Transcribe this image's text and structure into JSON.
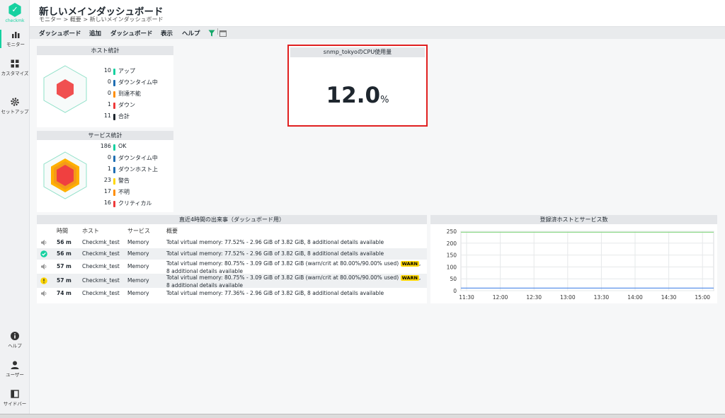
{
  "nav": {
    "logo_text": "checkmk",
    "items": [
      {
        "label": "モニター"
      },
      {
        "label": "カスタマイズ"
      },
      {
        "label": "セットアップ"
      },
      {
        "label": "ヘルプ"
      },
      {
        "label": "ユーザー"
      },
      {
        "label": "サイドバー"
      }
    ]
  },
  "header": {
    "title": "新しいメインダッシュボード",
    "breadcrumb": "モニター > 概要 > 新しいメインダッシュボード"
  },
  "menu": [
    "ダッシュボード",
    "追加",
    "ダッシュボード",
    "表示",
    "ヘルプ"
  ],
  "host_stats": {
    "title": "ホスト統計",
    "rows": [
      {
        "value": "10",
        "label": "アップ",
        "color": "#15d1a0"
      },
      {
        "value": "0",
        "label": "ダウンタイム中",
        "color": "#1f6eb3"
      },
      {
        "value": "0",
        "label": "到達不能",
        "color": "#ff8e00"
      },
      {
        "value": "1",
        "label": "ダウン",
        "color": "#ee3a3a"
      },
      {
        "value": "11",
        "label": "合計",
        "color": "#1e262e"
      }
    ]
  },
  "service_stats": {
    "title": "サービス統計",
    "rows": [
      {
        "value": "186",
        "label": "OK",
        "color": "#15d1a0"
      },
      {
        "value": "0",
        "label": "ダウンタイム中",
        "color": "#1f6eb3"
      },
      {
        "value": "1",
        "label": "ダウンホスト上",
        "color": "#1f6eb3"
      },
      {
        "value": "23",
        "label": "警告",
        "color": "#ffd703"
      },
      {
        "value": "17",
        "label": "不明",
        "color": "#ff8e00"
      },
      {
        "value": "16",
        "label": "クリティカル",
        "color": "#ee3a3a"
      }
    ]
  },
  "cpu": {
    "title": "snmp_tokyoのCPU使用量",
    "value": "12.0",
    "unit": "%"
  },
  "events": {
    "title": "直近4時間の出来事（ダッシュボード用）",
    "headers": {
      "time": "時間",
      "host": "ホスト",
      "service": "サービス",
      "summary": "概要"
    },
    "rows": [
      {
        "icon": "speaker-icon",
        "time": "56 m",
        "host": "Checkmk_test",
        "service": "Memory",
        "summary": "Total virtual memory: 77.52% - 2.96 GiB of 3.82 GiB, 8 additional details available",
        "summary2": "",
        "warn": ""
      },
      {
        "icon": "ok-icon",
        "time": "56 m",
        "host": "Checkmk_test",
        "service": "Memory",
        "summary": "Total virtual memory: 77.52% - 2.96 GiB of 3.82 GiB, 8 additional details available",
        "summary2": "",
        "warn": ""
      },
      {
        "icon": "speaker-icon",
        "time": "57 m",
        "host": "Checkmk_test",
        "service": "Memory",
        "summary": "Total virtual memory: 80.75% - 3.09 GiB of 3.82 GiB (warn/crit at 80.00%/90.00% used)",
        "summary2": "8 additional details available",
        "warn": "WARN"
      },
      {
        "icon": "warn-icon",
        "time": "57 m",
        "host": "Checkmk_test",
        "service": "Memory",
        "summary": "Total virtual memory: 80.75% - 3.09 GiB of 3.82 GiB (warn/crit at 80.00%/90.00% used)",
        "summary2": "8 additional details available",
        "warn": "WARN"
      },
      {
        "icon": "speaker-icon",
        "time": "74 m",
        "host": "Checkmk_test",
        "service": "Memory",
        "summary": "Total virtual memory: 77.36% - 2.96 GiB of 3.82 GiB, 8 additional details available",
        "summary2": "",
        "warn": ""
      }
    ]
  },
  "chart_data": {
    "type": "line",
    "title": "登録済ホストとサービス数",
    "x": [
      "11:30",
      "12:00",
      "12:30",
      "13:00",
      "13:30",
      "14:00",
      "14:30",
      "15:00"
    ],
    "ylim": [
      0,
      250
    ],
    "yticks": [
      "250",
      "200",
      "150",
      "100",
      "50",
      "0"
    ],
    "series": [
      {
        "color": "#8fd98a",
        "values": [
          246,
          246,
          246,
          246,
          246,
          246,
          246,
          246
        ]
      },
      {
        "color": "#4a86e8",
        "values": [
          11,
          11,
          11,
          11,
          11,
          11,
          11,
          11
        ]
      }
    ],
    "grid": true
  }
}
